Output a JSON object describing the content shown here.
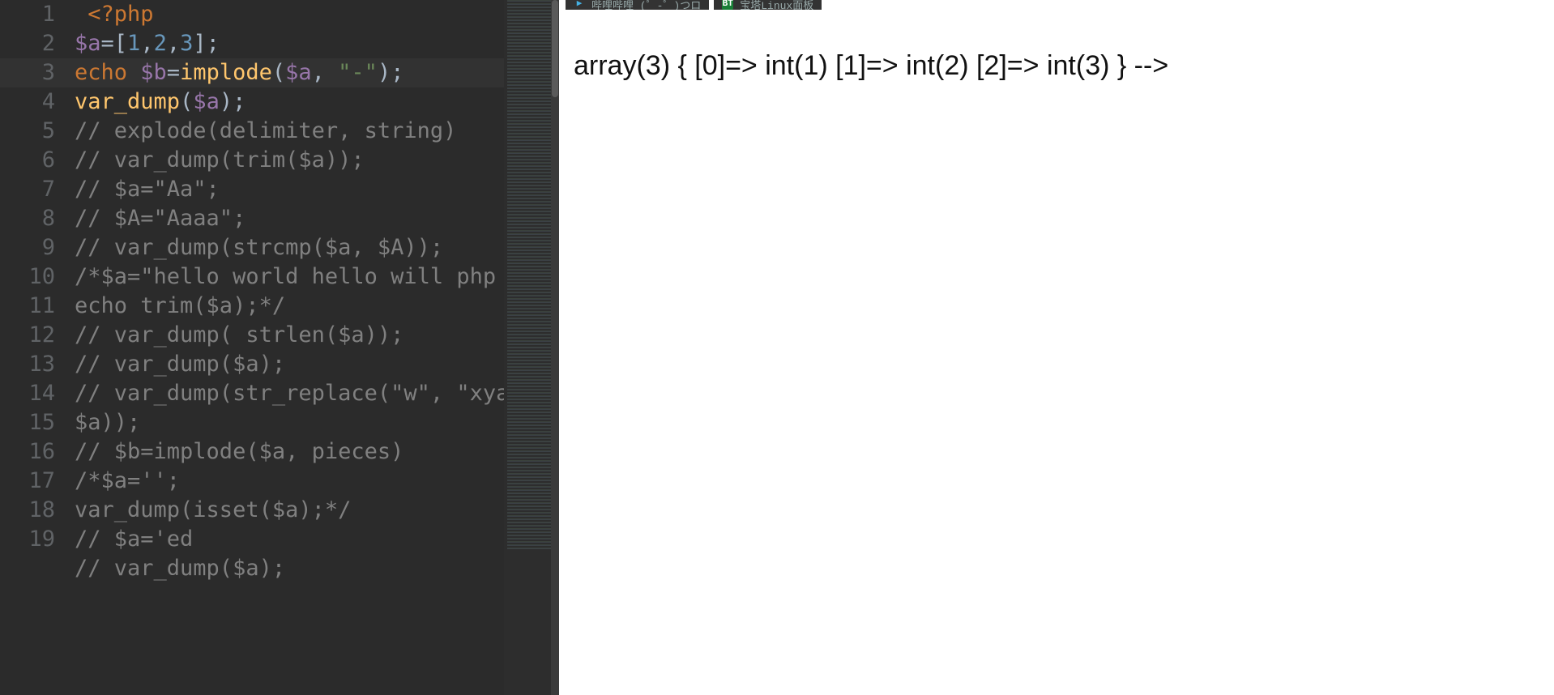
{
  "editor": {
    "lineNumbers": [
      "1",
      "2",
      "3",
      "4",
      "5",
      "6",
      "7",
      "8",
      "9",
      "10",
      "11",
      "12",
      "13",
      "14",
      "",
      "15",
      "16",
      "17",
      "18",
      "19"
    ],
    "currentLine": 3,
    "lines": [
      [
        {
          "t": "plain",
          "v": " "
        },
        {
          "t": "punc",
          "v": "<?"
        },
        {
          "t": "kw",
          "v": "php"
        }
      ],
      [
        {
          "t": "var",
          "v": "$a"
        },
        {
          "t": "op",
          "v": "="
        },
        {
          "t": "plain",
          "v": "["
        },
        {
          "t": "num",
          "v": "1"
        },
        {
          "t": "plain",
          "v": ","
        },
        {
          "t": "num",
          "v": "2"
        },
        {
          "t": "plain",
          "v": ","
        },
        {
          "t": "num",
          "v": "3"
        },
        {
          "t": "plain",
          "v": "];"
        }
      ],
      [
        {
          "t": "kw",
          "v": "echo "
        },
        {
          "t": "var",
          "v": "$b"
        },
        {
          "t": "op",
          "v": "="
        },
        {
          "t": "fn",
          "v": "implode"
        },
        {
          "t": "plain",
          "v": "("
        },
        {
          "t": "var",
          "v": "$a"
        },
        {
          "t": "plain",
          "v": ", "
        },
        {
          "t": "str",
          "v": "\"-\""
        },
        {
          "t": "plain",
          "v": ");"
        }
      ],
      [
        {
          "t": "fn",
          "v": "var_dump"
        },
        {
          "t": "plain",
          "v": "("
        },
        {
          "t": "var",
          "v": "$a"
        },
        {
          "t": "plain",
          "v": ");"
        }
      ],
      [
        {
          "t": "cmt",
          "v": "// explode(delimiter, string)"
        }
      ],
      [
        {
          "t": "cmt",
          "v": "// var_dump(trim($a));"
        }
      ],
      [
        {
          "t": "cmt",
          "v": "// $a=\"Aa\";"
        }
      ],
      [
        {
          "t": "cmt",
          "v": "// $A=\"Aaaa\";"
        }
      ],
      [
        {
          "t": "cmt",
          "v": "// var_dump(strcmp($a, $A));"
        }
      ],
      [
        {
          "t": "cmt",
          "v": "/*$a=\"hello world hello will php w\";"
        }
      ],
      [
        {
          "t": "cmt",
          "v": "echo trim($a);*/"
        }
      ],
      [
        {
          "t": "cmt",
          "v": "// var_dump( strlen($a));"
        }
      ],
      [
        {
          "t": "cmt",
          "v": "// var_dump($a);"
        }
      ],
      [
        {
          "t": "cmt",
          "v": "// var_dump(str_replace(\"w\", \"xya\", "
        }
      ],
      [
        {
          "t": "cmt",
          "v": "$a));"
        }
      ],
      [
        {
          "t": "cmt",
          "v": "// $b=implode($a, pieces)"
        }
      ],
      [
        {
          "t": "cmt",
          "v": "/*$a='';"
        }
      ],
      [
        {
          "t": "cmt",
          "v": "var_dump(isset($a);*/"
        }
      ],
      [
        {
          "t": "cmt",
          "v": "// $a='ed"
        }
      ],
      [
        {
          "t": "cmt",
          "v": "// var_dump($a);"
        }
      ]
    ]
  },
  "browser": {
    "tabs": [
      {
        "icon": "bili",
        "title": "哔哩哔哩 (゜-゜)つロ"
      },
      {
        "icon": "bt",
        "title": "宝塔Linux面板"
      }
    ]
  },
  "output": {
    "text": "array(3) { [0]=> int(1) [1]=> int(2) [2]=> int(3) } -->"
  }
}
